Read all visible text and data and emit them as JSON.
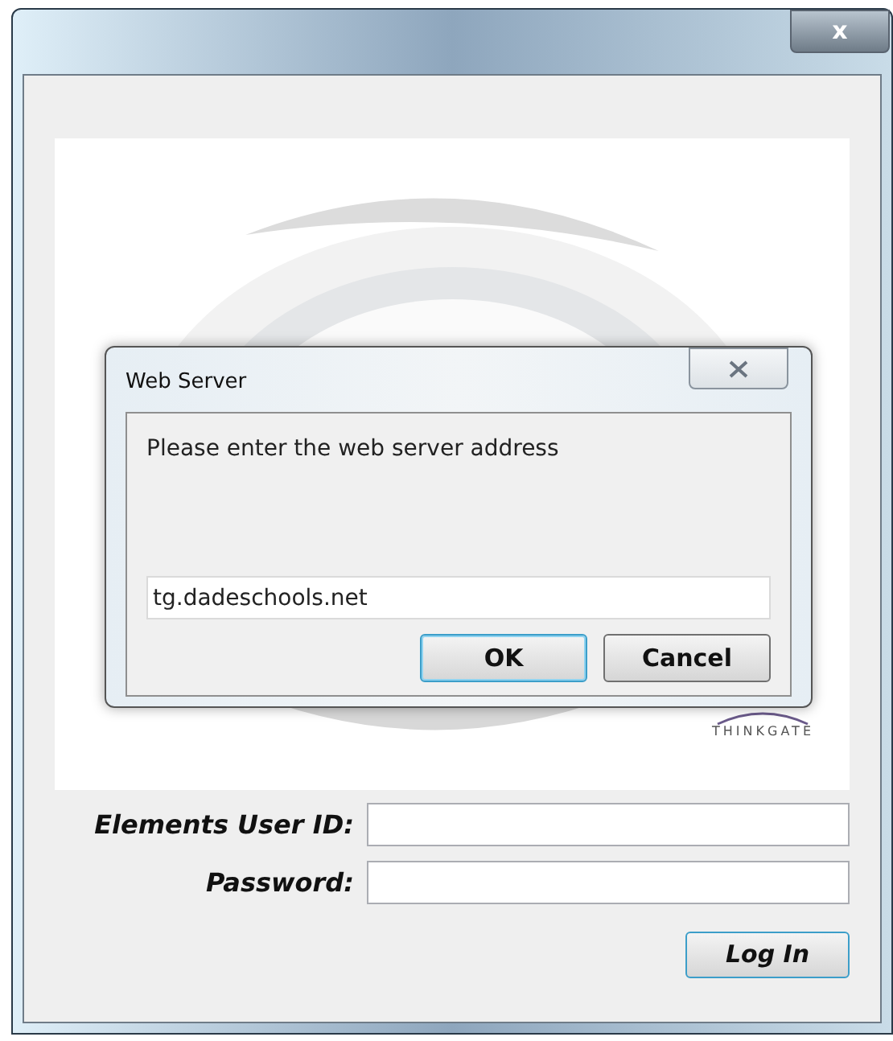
{
  "window": {
    "close_button": "x"
  },
  "splash": {
    "kind": "picture",
    "logo": "THINKGATE"
  },
  "dialog": {
    "title": "Web Server",
    "prompt": "Please enter the web server address",
    "value": "tg.dadeschools.net",
    "buttons": [
      {
        "label": "OK",
        "selected": true
      },
      {
        "label": "Cancel",
        "selected": false
      }
    ]
  },
  "login": {
    "fields": [
      {
        "label": "Elements User ID:"
      },
      {
        "label": "Password:"
      }
    ],
    "button": "Log In"
  }
}
